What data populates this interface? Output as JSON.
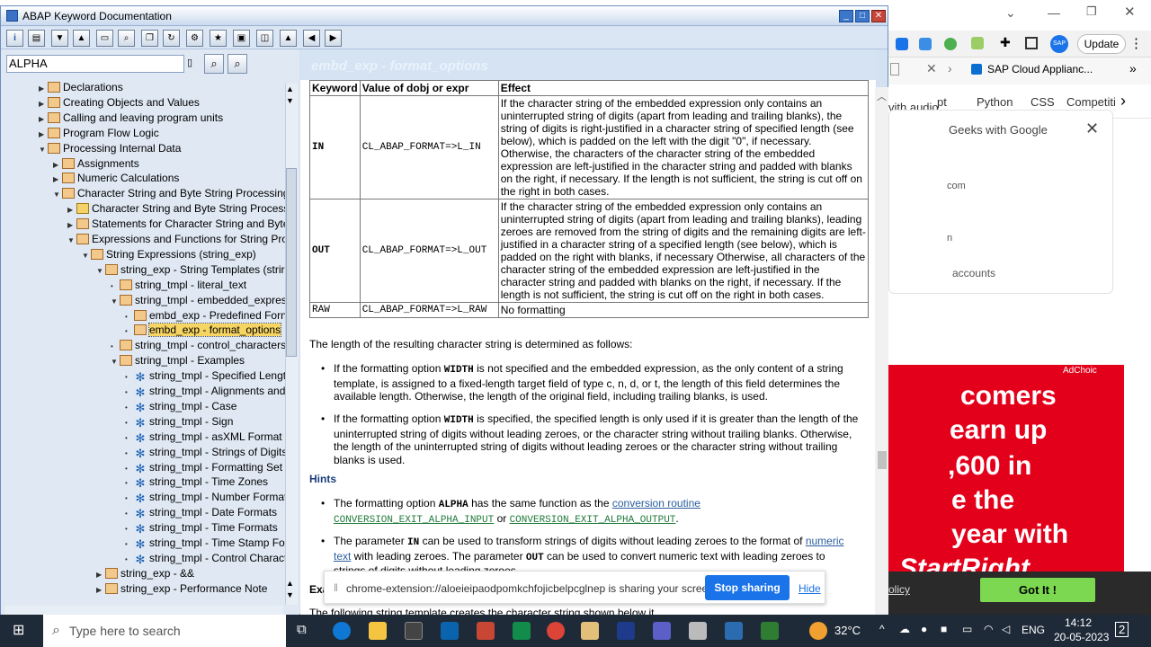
{
  "window": {
    "title": "ABAP Keyword Documentation"
  },
  "search": {
    "value": "ALPHA"
  },
  "tree": [
    {
      "label": "Declarations",
      "indent": 0,
      "exp": "right",
      "icon": "book"
    },
    {
      "label": "Creating Objects and Values",
      "indent": 0,
      "exp": "right",
      "icon": "book"
    },
    {
      "label": "Calling and leaving program units",
      "indent": 0,
      "exp": "right",
      "icon": "book"
    },
    {
      "label": "Program Flow Logic",
      "indent": 0,
      "exp": "right",
      "icon": "book"
    },
    {
      "label": "Processing Internal Data",
      "indent": 0,
      "exp": "down",
      "icon": "book"
    },
    {
      "label": "Assignments",
      "indent": 1,
      "exp": "right",
      "icon": "book"
    },
    {
      "label": "Numeric Calculations",
      "indent": 1,
      "exp": "right",
      "icon": "book"
    },
    {
      "label": "Character String and Byte String Processing",
      "indent": 1,
      "exp": "down",
      "icon": "book"
    },
    {
      "label": "Character String and Byte String Processi",
      "indent": 2,
      "exp": "right",
      "icon": "people"
    },
    {
      "label": "Statements for Character String and Byte",
      "indent": 2,
      "exp": "right",
      "icon": "book"
    },
    {
      "label": "Expressions and Functions for String Proc",
      "indent": 2,
      "exp": "down",
      "icon": "book"
    },
    {
      "label": "String Expressions (string_exp)",
      "indent": 3,
      "exp": "down",
      "icon": "book"
    },
    {
      "label": "string_exp - String Templates (strir",
      "indent": 4,
      "exp": "down",
      "icon": "book"
    },
    {
      "label": "string_tmpl - literal_text",
      "indent": 5,
      "exp": "dot",
      "icon": "book"
    },
    {
      "label": "string_tmpl - embedded_expres",
      "indent": 5,
      "exp": "down",
      "icon": "book"
    },
    {
      "label": "embd_exp - Predefined Forn",
      "indent": 6,
      "exp": "dot",
      "icon": "book"
    },
    {
      "label": "embd_exp - format_options",
      "indent": 6,
      "exp": "dot",
      "icon": "book",
      "selected": true
    },
    {
      "label": "string_tmpl - control_characters",
      "indent": 5,
      "exp": "dot",
      "icon": "book"
    },
    {
      "label": "string_tmpl - Examples",
      "indent": 5,
      "exp": "down",
      "icon": "page"
    },
    {
      "label": "string_tmpl - Specified Lengt",
      "indent": 6,
      "exp": "dot",
      "icon": "gear"
    },
    {
      "label": "string_tmpl - Alignments and",
      "indent": 6,
      "exp": "dot",
      "icon": "gear"
    },
    {
      "label": "string_tmpl - Case",
      "indent": 6,
      "exp": "dot",
      "icon": "gear"
    },
    {
      "label": "string_tmpl - Sign",
      "indent": 6,
      "exp": "dot",
      "icon": "gear"
    },
    {
      "label": "string_tmpl - asXML Format",
      "indent": 6,
      "exp": "dot",
      "icon": "gear"
    },
    {
      "label": "string_tmpl - Strings of Digits",
      "indent": 6,
      "exp": "dot",
      "icon": "gear"
    },
    {
      "label": "string_tmpl - Formatting Set",
      "indent": 6,
      "exp": "dot",
      "icon": "gear"
    },
    {
      "label": "string_tmpl - Time Zones",
      "indent": 6,
      "exp": "dot",
      "icon": "gear"
    },
    {
      "label": "string_tmpl - Number Format",
      "indent": 6,
      "exp": "dot",
      "icon": "gear"
    },
    {
      "label": "string_tmpl - Date Formats",
      "indent": 6,
      "exp": "dot",
      "icon": "gear"
    },
    {
      "label": "string_tmpl - Time Formats",
      "indent": 6,
      "exp": "dot",
      "icon": "gear"
    },
    {
      "label": "string_tmpl - Time Stamp Fo",
      "indent": 6,
      "exp": "dot",
      "icon": "gear"
    },
    {
      "label": "string_tmpl - Control Charact",
      "indent": 6,
      "exp": "dot",
      "icon": "gear"
    },
    {
      "label": "string_exp - &&",
      "indent": 4,
      "exp": "right",
      "icon": "book"
    },
    {
      "label": "string_exp - Performance Note",
      "indent": 4,
      "exp": "right",
      "icon": "clock"
    }
  ],
  "content": {
    "header": "embd_exp - format_options",
    "table": {
      "headers": [
        "Keyword",
        "Value of dobj or expr",
        "Effect"
      ],
      "rows": [
        {
          "kw": "IN",
          "val": "CL_ABAP_FORMAT=>L_IN",
          "effect": "If the character string of the embedded expression only contains an uninterrupted string of digits (apart from leading and trailing blanks), the string of digits is right-justified in a character string of specified length (see below), which is padded on the left with the digit \"0\", if necessary. Otherwise, the characters of the character string of the embedded expression are left-justified in the character string and padded with blanks on the right, if necessary. If the length is not sufficient, the string is cut off on the right in both cases."
        },
        {
          "kw": "OUT",
          "val": "CL_ABAP_FORMAT=>L_OUT",
          "effect": "If the character string of the embedded expression only contains an uninterrupted string of digits (apart from leading and trailing blanks), leading zeroes are removed from the string of digits and the remaining digits are left-justified in a character string of a specified length (see below), which is padded on the right with blanks, if necessary Otherwise, all characters of the character string of the embedded expression are left-justified in the character string and padded with blanks on the right, if necessary. If the length is not sufficient, the string is cut off on the right in both cases."
        },
        {
          "kw": "RAW",
          "val": "CL_ABAP_FORMAT=>L_RAW",
          "effect": "No formatting"
        }
      ]
    },
    "length_intro": "The length of the resulting character string is determined as follows:",
    "bullet1_a": "If the formatting option ",
    "bullet1_code": "WIDTH",
    "bullet1_b": " is not specified and the embedded expression, as the only content of a string template, is assigned to a fixed-length target field of type c, n, d, or t, the length of this field determines the available length. Otherwise, the length of the original field, including trailing blanks, is used.",
    "bullet2_a": "If the formatting option ",
    "bullet2_code": "WIDTH",
    "bullet2_b": " is specified, the specified length is only used if it is greater than the length of the uninterrupted string of digits without leading zeroes, or the character string without trailing blanks. Otherwise, the length of the uninterrupted string of digits without leading zeroes or the character string without trailing blanks is used.",
    "hints": "Hints",
    "hint1_a": "The formatting option ",
    "hint1_code": "ALPHA",
    "hint1_b": " has the same function as the ",
    "hint1_link": "conversion routine",
    "hint1_l1": "CONVERSION_EXIT_ALPHA_INPUT",
    "hint1_or": " or ",
    "hint1_l2": "CONVERSION_EXIT_ALPHA_OUTPUT",
    "hint1_end": ".",
    "hint2_a": "The parameter ",
    "hint2_in": "IN",
    "hint2_b": " can be used to transform strings of digits without leading zeroes to the format of ",
    "hint2_link1": "numeric",
    "hint2_link2": "text",
    "hint2_c": " with leading zeroes. The parameter ",
    "hint2_out": "OUT",
    "hint2_d": " can be used to convert numeric text with leading zeroes to strings of digits without leading zeroes.",
    "example": "Exa",
    "example_line": "The following string template creates the character string shown below it."
  },
  "share": {
    "message": "chrome-extension://aloeieipaodpomkchfojicbelpcglnep is sharing your screen.",
    "stop": "Stop sharing",
    "hide": "Hide"
  },
  "browser": {
    "update": "Update",
    "bookmark": "SAP Cloud Applianc...",
    "links": [
      "pt",
      "Python",
      "CSS",
      "Competiti"
    ],
    "audio": "vith audio",
    "google": "Geeks with Google",
    "com": "com",
    "n": "n",
    "accounts": "accounts",
    "adchoices": "AdChoic",
    "ad_lines": [
      "comers",
      "earn up",
      ",600 in",
      "e the",
      "year with",
      "StartRight"
    ],
    "policy": "olicy",
    "gotit": "Got It !"
  },
  "taskbar": {
    "search": "Type here to search",
    "weather": "32°C",
    "lang": "ENG",
    "time": "14:12",
    "date": "20-05-2023",
    "notif": "2"
  }
}
